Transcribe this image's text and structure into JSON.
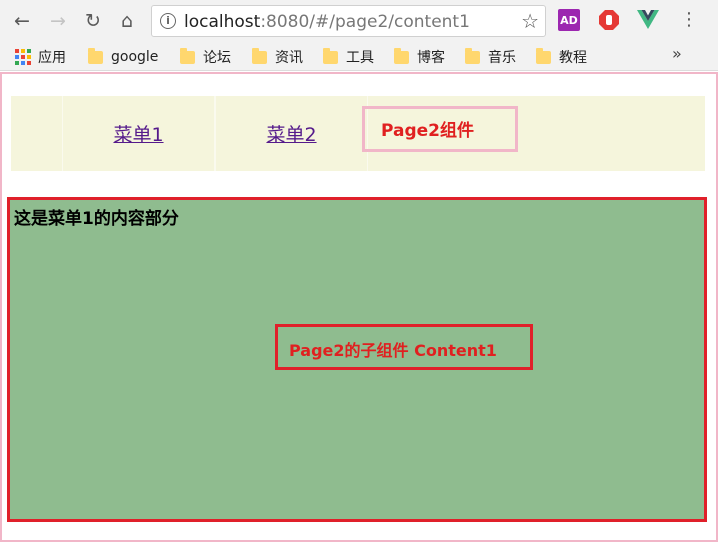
{
  "browser": {
    "url_host": "localhost",
    "url_rest": ":8080/#/page2/content1",
    "ext_ad_label": "AD"
  },
  "bookmarks": {
    "items": [
      "应用",
      "google",
      "论坛",
      "资讯",
      "工具",
      "博客",
      "音乐",
      "教程"
    ],
    "more": "»"
  },
  "app": {
    "menu": [
      "菜单1",
      "菜单2"
    ],
    "page_label": "Page2组件",
    "content_title": "这是菜单1的内容部分",
    "subcomponent_label": "Page2的子组件 Content1"
  },
  "colors": {
    "menu_bg": "#f5f5dc",
    "content_bg": "#8fbc8f",
    "accent_red": "#e0202a",
    "pink_border": "#f1b6c8"
  }
}
